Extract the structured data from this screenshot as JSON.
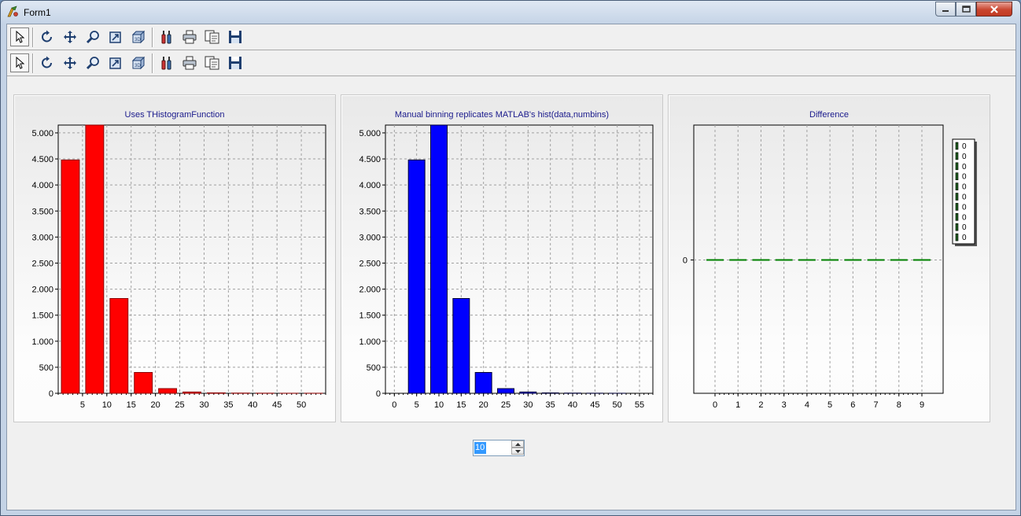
{
  "window": {
    "title": "Form1"
  },
  "toolbars": [
    {
      "buttons": [
        "pointer-icon",
        "rotate-icon",
        "move-icon",
        "zoom-icon",
        "zoom-extents-icon",
        "3d-box-icon",
        "separator",
        "editor-icon",
        "print-icon",
        "copy-icon",
        "save-icon"
      ]
    },
    {
      "buttons": [
        "pointer-icon",
        "rotate-icon",
        "move-icon",
        "zoom-icon",
        "zoom-extents-icon",
        "3d-box-icon",
        "separator",
        "editor-icon",
        "print-icon",
        "copy-icon",
        "save-icon"
      ]
    }
  ],
  "colors": {
    "series_1": "#ff0000",
    "series_2": "#0000ff",
    "series_3": "#008000",
    "title_text": "#1a1a8c"
  },
  "chart_data": [
    {
      "type": "bar",
      "title": "Uses THistogramFunction",
      "xlabel": "",
      "ylabel": "",
      "x": [
        2.5,
        7.5,
        12.5,
        17.5,
        22.5,
        27.5,
        32.5,
        37.5,
        42.5,
        47.5,
        52.5
      ],
      "values": [
        4480,
        5150,
        1820,
        400,
        90,
        25,
        8,
        4,
        2,
        1,
        1
      ],
      "xticks": [
        "5",
        "10",
        "15",
        "20",
        "25",
        "30",
        "35",
        "40",
        "45",
        "50"
      ],
      "yticks": [
        "0",
        "500",
        "1.000",
        "1.500",
        "2.000",
        "2.500",
        "3.000",
        "3.500",
        "4.000",
        "4.500",
        "5.000"
      ],
      "ylim": [
        0,
        5150
      ],
      "xlim": [
        0,
        55
      ],
      "grid": true,
      "color": "#ff0000"
    },
    {
      "type": "bar",
      "title": "Manual binning replicates MATLAB's hist(data,numbins)",
      "xlabel": "",
      "ylabel": "",
      "x": [
        5,
        10,
        15,
        20,
        25,
        30,
        35,
        40,
        45,
        50
      ],
      "values": [
        4480,
        5150,
        1820,
        400,
        90,
        25,
        8,
        4,
        2,
        1
      ],
      "xticks": [
        "0",
        "5",
        "10",
        "15",
        "20",
        "25",
        "30",
        "35",
        "40",
        "45",
        "50",
        "55"
      ],
      "yticks": [
        "0",
        "500",
        "1.000",
        "1.500",
        "2.000",
        "2.500",
        "3.000",
        "3.500",
        "4.000",
        "4.500",
        "5.000"
      ],
      "ylim": [
        0,
        5150
      ],
      "xlim": [
        -2,
        58
      ],
      "grid": true,
      "color": "#0000ff"
    },
    {
      "type": "bar",
      "title": "Difference",
      "xlabel": "",
      "ylabel": "",
      "categories": [
        "0",
        "1",
        "2",
        "3",
        "4",
        "5",
        "6",
        "7",
        "8",
        "9"
      ],
      "values": [
        0,
        0,
        0,
        0,
        0,
        0,
        0,
        0,
        0,
        0
      ],
      "yticks": [
        "0"
      ],
      "grid": true,
      "legend": {
        "placement": "right",
        "entries": [
          "0",
          "0",
          "0",
          "0",
          "0",
          "0",
          "0",
          "0",
          "0",
          "0"
        ]
      },
      "color": "#008000"
    }
  ],
  "spin": {
    "value": "10"
  }
}
